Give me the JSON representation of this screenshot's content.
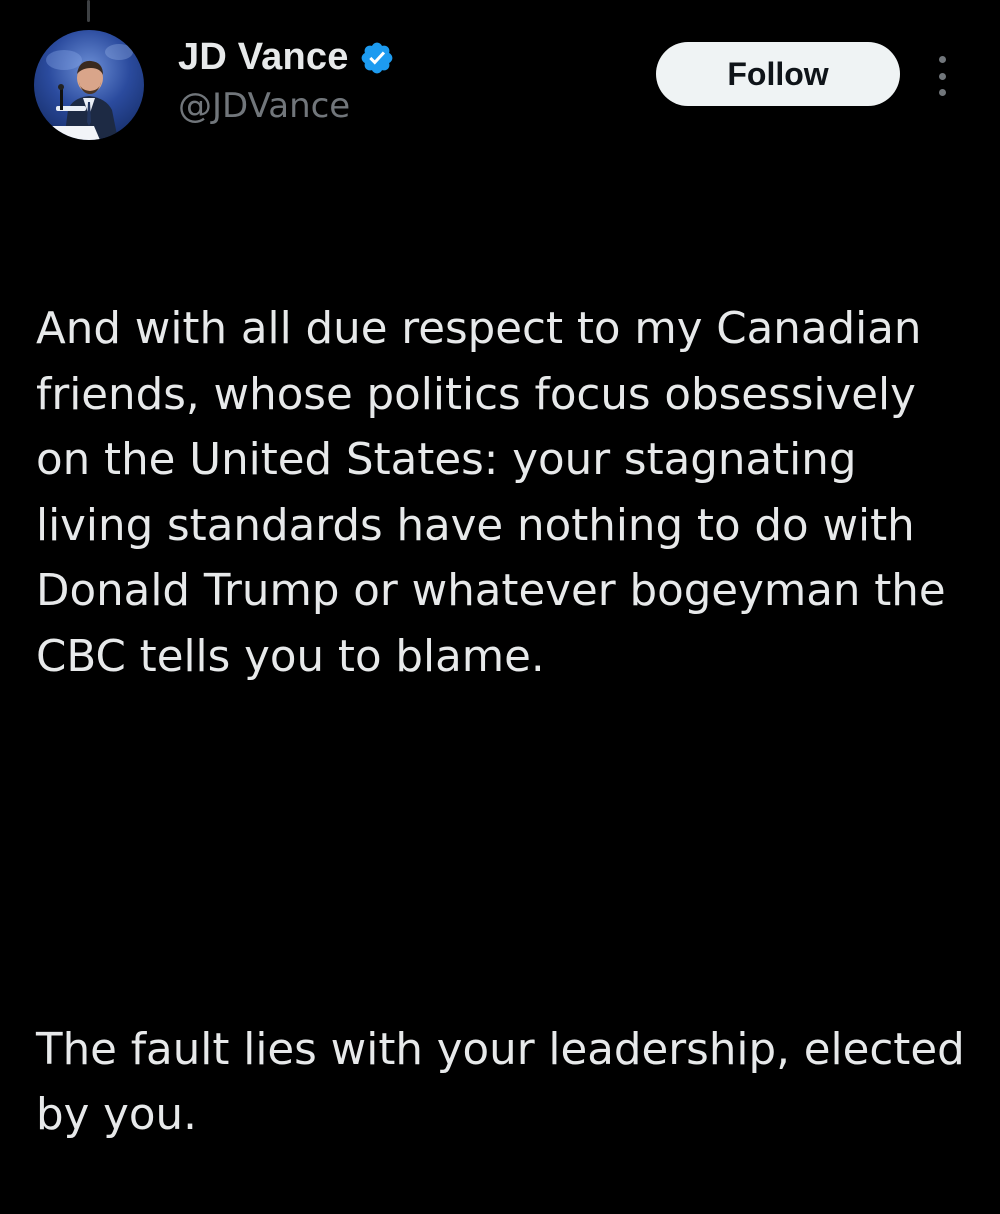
{
  "author": {
    "display_name": "JD Vance",
    "handle": "@JDVance",
    "verified": true,
    "avatar_icon": "profile-photo"
  },
  "actions": {
    "follow_label": "Follow",
    "more_icon": "more-vertical-icon"
  },
  "tweet": {
    "paragraph_1": "And with all due respect to my Canadian friends, whose politics focus obsessively on the United States: your stagnating living standards have nothing to do with Donald Trump or whatever bogeyman the CBC tells you to blame.",
    "paragraph_2": "The fault lies with your leadership, elected by you."
  },
  "colors": {
    "background": "#000000",
    "text_primary": "#e7e9ea",
    "text_secondary": "#71767b",
    "verified_blue": "#1d9bf0",
    "follow_button_bg": "#eff3f4",
    "follow_button_text": "#0f1419"
  }
}
